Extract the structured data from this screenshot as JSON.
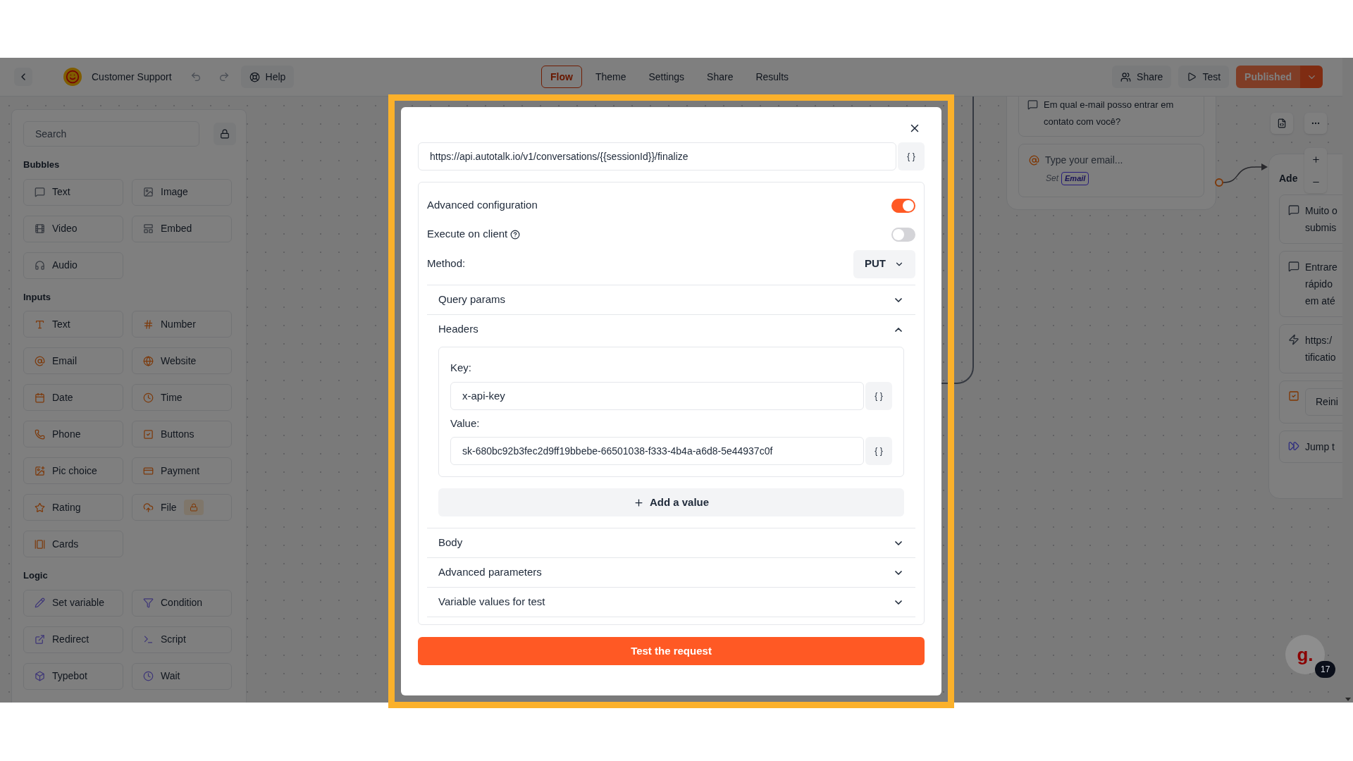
{
  "top_bar": {
    "project_name": "Customer Support",
    "help": "Help",
    "tabs": [
      {
        "label": "Flow",
        "selected": true
      },
      {
        "label": "Theme",
        "selected": false
      },
      {
        "label": "Settings",
        "selected": false
      },
      {
        "label": "Share",
        "selected": false
      },
      {
        "label": "Results",
        "selected": false
      }
    ],
    "share": "Share",
    "test": "Test",
    "publish": "Published"
  },
  "sidebar": {
    "search_placeholder": "Search",
    "sections": [
      {
        "title": "Bubbles",
        "items": [
          {
            "label": "Text",
            "locked": false
          },
          {
            "label": "Image",
            "locked": false
          },
          {
            "label": "Video",
            "locked": false
          },
          {
            "label": "Embed",
            "locked": false
          },
          {
            "label": "Audio",
            "locked": false
          }
        ]
      },
      {
        "title": "Inputs",
        "items": [
          {
            "label": "Text",
            "locked": false
          },
          {
            "label": "Number",
            "locked": false
          },
          {
            "label": "Email",
            "locked": false
          },
          {
            "label": "Website",
            "locked": false
          },
          {
            "label": "Date",
            "locked": false
          },
          {
            "label": "Time",
            "locked": false
          },
          {
            "label": "Phone",
            "locked": false
          },
          {
            "label": "Buttons",
            "locked": false
          },
          {
            "label": "Pic choice",
            "locked": false
          },
          {
            "label": "Payment",
            "locked": false
          },
          {
            "label": "Rating",
            "locked": false
          },
          {
            "label": "File",
            "locked": true
          },
          {
            "label": "Cards",
            "locked": false
          }
        ]
      },
      {
        "title": "Logic",
        "items": [
          {
            "label": "Set variable",
            "locked": false
          },
          {
            "label": "Condition",
            "locked": false
          },
          {
            "label": "Redirect",
            "locked": false
          },
          {
            "label": "Script",
            "locked": false
          },
          {
            "label": "Typebot",
            "locked": false
          },
          {
            "label": "Wait",
            "locked": false
          }
        ]
      }
    ]
  },
  "canvas": {
    "group": {
      "bubble_text": "Em qual e-mail posso entrar em contato com você?",
      "input_placeholder": "Type your email...",
      "set_label": "Set",
      "variable": "Email"
    },
    "next_group": {
      "title": "Ade",
      "items": [
        {
          "kind": "text",
          "lines": [
            "Muito o",
            "submis"
          ]
        },
        {
          "kind": "text",
          "lines": [
            "Entrare",
            "rápido",
            "em até"
          ]
        },
        {
          "kind": "webhook",
          "lines": [
            "https:/",
            "tificatio"
          ]
        },
        {
          "kind": "buttons",
          "lines": [
            "Reini"
          ]
        },
        {
          "kind": "jump",
          "lines": [
            "Jump t"
          ]
        }
      ]
    }
  },
  "modal": {
    "url": "https://api.autotalk.io/v1/conversations/{{sessionId}}/finalize",
    "url_variable_button": "{ }",
    "toggles": [
      {
        "label": "Advanced configuration",
        "on": true,
        "help": false
      },
      {
        "label": "Execute on client",
        "on": false,
        "help": true
      }
    ],
    "method": {
      "label": "Method:",
      "value": "PUT"
    },
    "sections": [
      {
        "title": "Query params",
        "expanded": false
      },
      {
        "title": "Headers",
        "expanded": true
      },
      {
        "title": "Body",
        "expanded": false
      },
      {
        "title": "Advanced parameters",
        "expanded": false
      },
      {
        "title": "Variable values for test",
        "expanded": false
      }
    ],
    "headers": {
      "key_label": "Key:",
      "key": "x-api-key",
      "key_variable_button": "{ }",
      "value_variable_button": "{ }",
      "value_label": "Value:",
      "value": "sk-680bc92b3fec2d9ff19bbebe-66501038-f333-4b4a-a6d8-5e44937c0f",
      "add_button": "Add a value"
    },
    "test_button": "Test the request"
  },
  "help_widget": {
    "logo": "g.",
    "badge": "17"
  }
}
